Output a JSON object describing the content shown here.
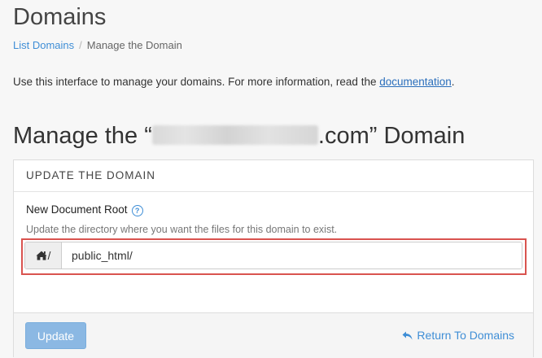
{
  "page": {
    "title": "Domains"
  },
  "breadcrumb": {
    "items": [
      {
        "label": "List Domains"
      },
      {
        "label": "Manage the Domain"
      }
    ],
    "separator": "/"
  },
  "intro": {
    "text": "Use this interface to manage your domains. For more information, read the ",
    "link_label": "documentation",
    "suffix": "."
  },
  "section": {
    "title_prefix": "Manage the “",
    "title_suffix": ".com” Domain"
  },
  "panel": {
    "heading": "UPDATE THE DOMAIN",
    "field": {
      "label": "New Document Root",
      "help_icon": "help-circle-icon",
      "hint": "Update the directory where you want the files for this domain to exist.",
      "prefix_icon": "home-icon",
      "prefix_text": "/",
      "value": "public_html/"
    },
    "footer": {
      "update_label": "Update",
      "return_label": "Return To Domains",
      "return_icon": "reply-arrow-icon"
    }
  },
  "colors": {
    "link": "#3f8ed6",
    "highlight": "#d9534f",
    "button": "#8bb8e3"
  }
}
